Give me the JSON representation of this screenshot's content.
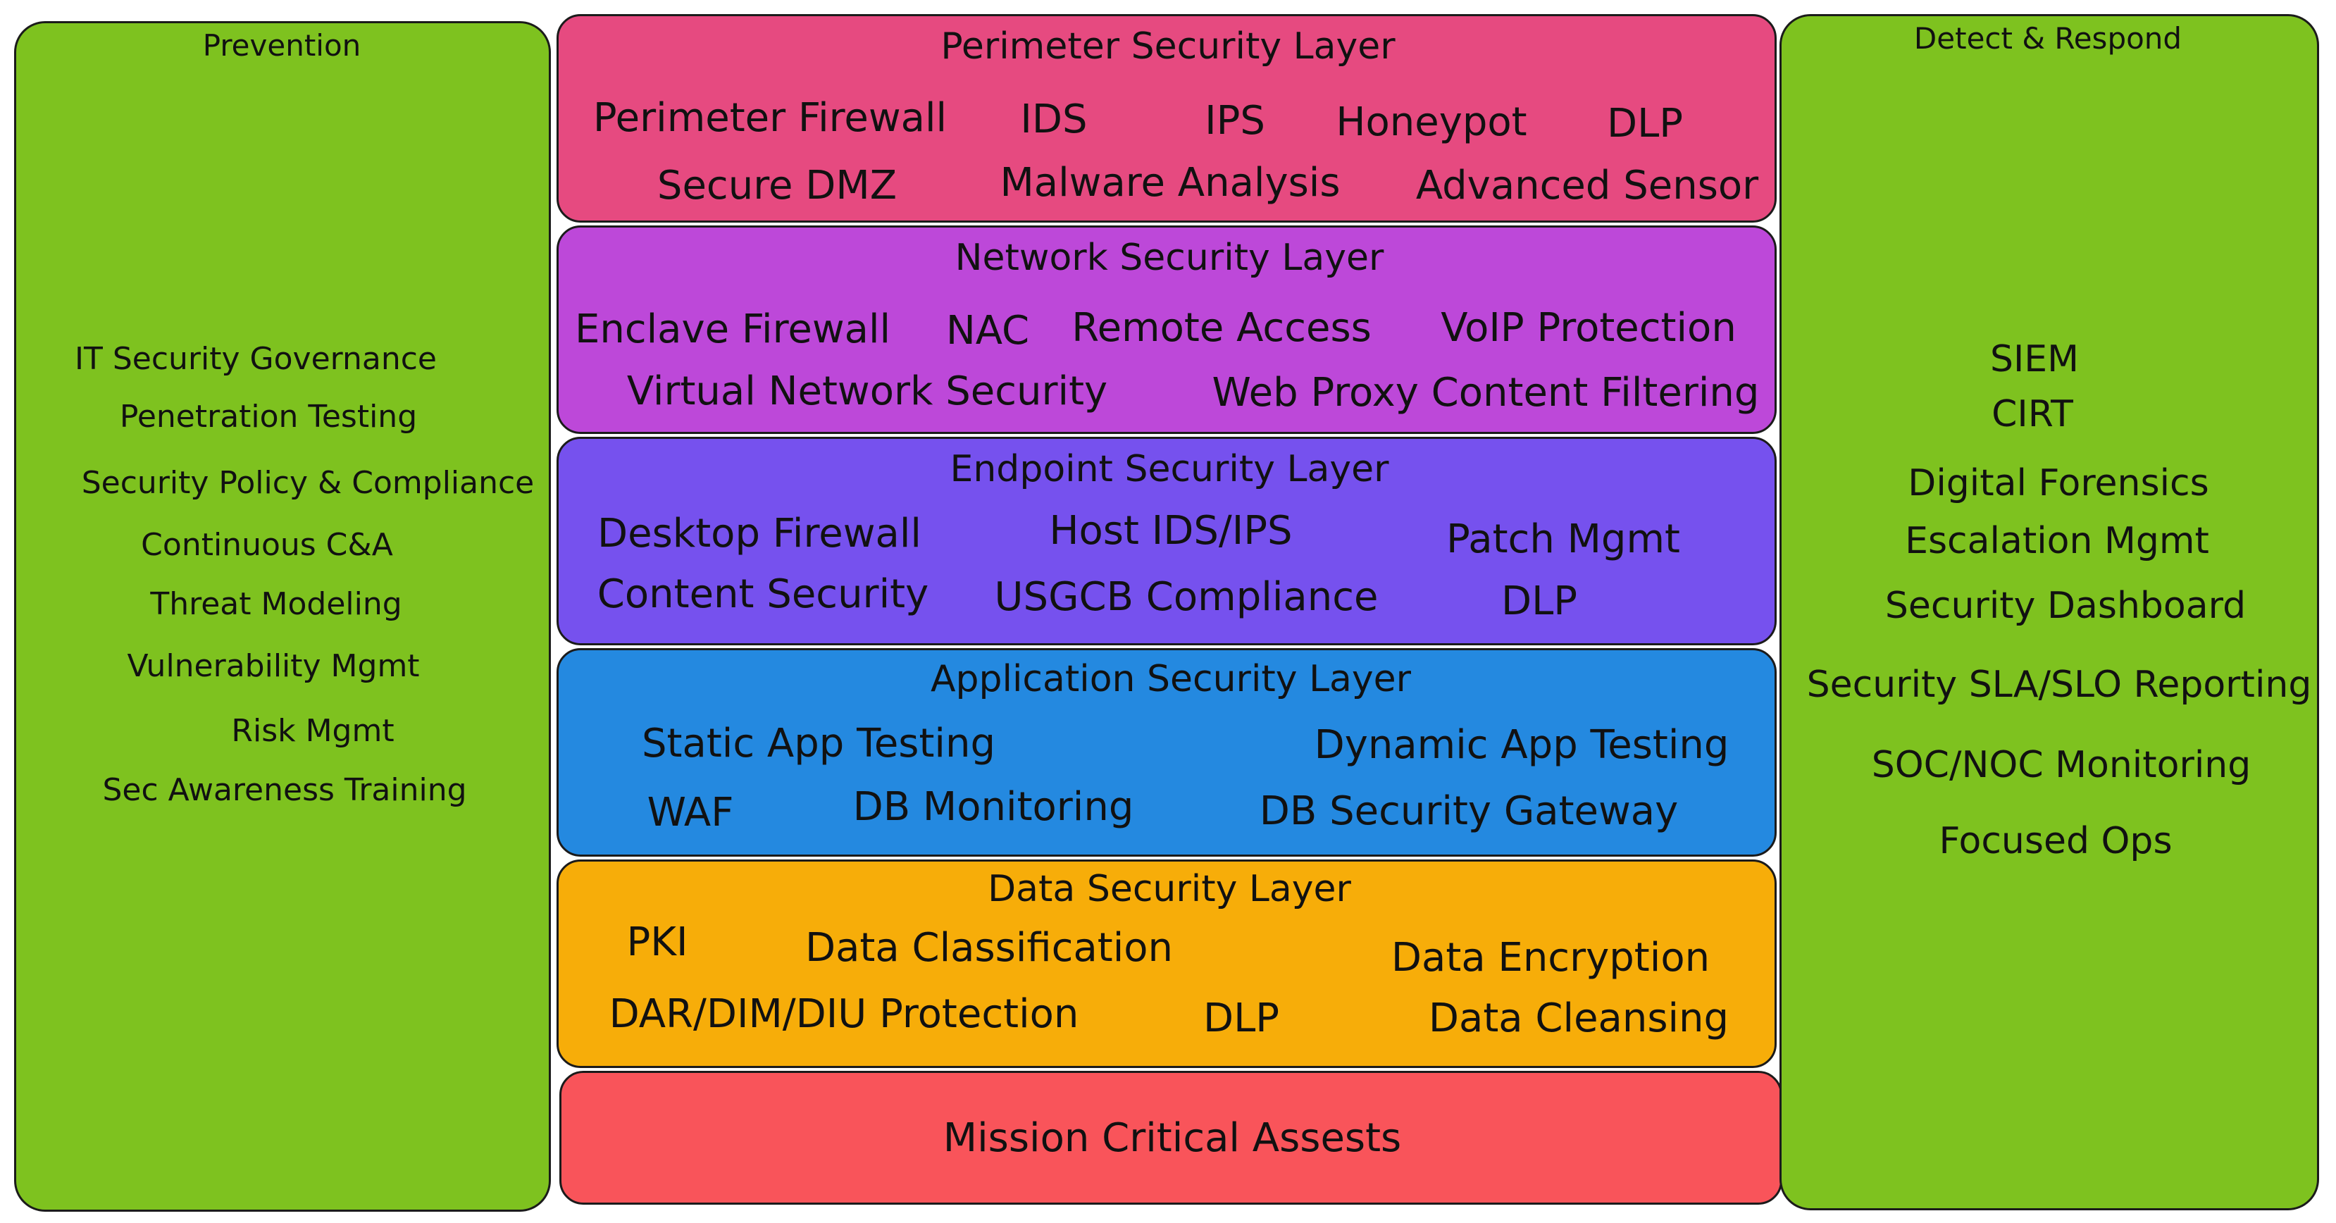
{
  "colors": {
    "prevention": "#7ec21f",
    "detect_respond": "#7ec21f",
    "perimeter": "#e64a80",
    "network": "#bd48d9",
    "endpoint": "#7651ee",
    "application": "#2489e0",
    "data": "#f7ad09",
    "mission": "#f9545a"
  },
  "prevention": {
    "title": "Prevention",
    "items": [
      "IT Security Governance",
      "Penetration Testing",
      "Security Policy & Compliance",
      "Continuous C&A",
      "Threat Modeling",
      "Vulnerability Mgmt",
      "Risk Mgmt",
      "Sec Awareness Training"
    ]
  },
  "detect_respond": {
    "title": "Detect & Respond",
    "items": [
      "SIEM",
      "CIRT",
      "Digital Forensics",
      "Escalation Mgmt",
      "Security Dashboard",
      "Security SLA/SLO Reporting",
      "SOC/NOC Monitoring",
      "Focused Ops"
    ]
  },
  "layers": {
    "perimeter": {
      "title": "Perimeter Security Layer",
      "items": [
        "Perimeter Firewall",
        "IDS",
        "IPS",
        "Honeypot",
        "DLP",
        "Secure DMZ",
        "Malware Analysis",
        "Advanced Sensor"
      ]
    },
    "network": {
      "title": "Network Security Layer",
      "items": [
        "Enclave Firewall",
        "NAC",
        "Remote Access",
        "VoIP Protection",
        "Virtual Network Security",
        "Web Proxy Content Filtering"
      ]
    },
    "endpoint": {
      "title": "Endpoint Security Layer",
      "items": [
        "Desktop Firewall",
        "Host IDS/IPS",
        "Patch Mgmt",
        "Content Security",
        "USGCB Compliance",
        "DLP"
      ]
    },
    "application": {
      "title": "Application Security Layer",
      "items": [
        "Static App Testing",
        "Dynamic App Testing",
        "WAF",
        "DB Monitoring",
        "DB Security Gateway"
      ]
    },
    "data": {
      "title": "Data Security Layer",
      "items": [
        "PKI",
        "Data Classification",
        "Data Encryption",
        "DAR/DIM/DIU Protection",
        "DLP",
        "Data Cleansing"
      ]
    },
    "mission": {
      "title": "Mission Critical Assests"
    }
  }
}
